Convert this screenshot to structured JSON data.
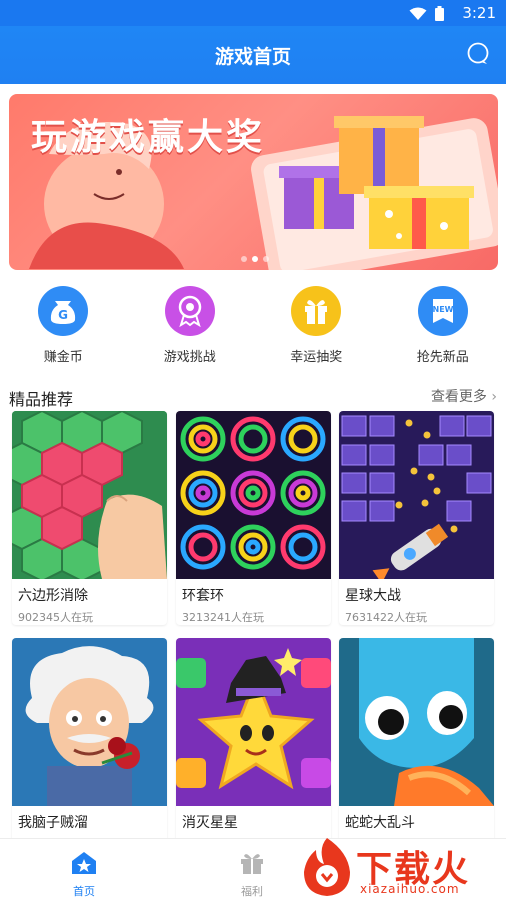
{
  "status": {
    "time": "3:21"
  },
  "header": {
    "title": "游戏首页"
  },
  "banner": {
    "slogan": "玩游戏赢大奖"
  },
  "quick_entries": [
    {
      "label": "赚金币",
      "icon": "gold-coin-bag-icon",
      "color": "#2f8cf5"
    },
    {
      "label": "游戏挑战",
      "icon": "medal-icon",
      "color": "#c850e6"
    },
    {
      "label": "幸运抽奖",
      "icon": "gift-icon",
      "color": "#f7c21a"
    },
    {
      "label": "抢先新品",
      "icon": "new-badge-icon",
      "color": "#2f8cf5"
    }
  ],
  "section": {
    "title": "精品推荐",
    "more": "查看更多"
  },
  "games": [
    {
      "name": "六边形消除",
      "players": "902345人在玩"
    },
    {
      "name": "环套环",
      "players": "3213241人在玩"
    },
    {
      "name": "星球大战",
      "players": "7631422人在玩"
    },
    {
      "name": "我脑子贼溜",
      "players": ""
    },
    {
      "name": "消灭星星",
      "players": ""
    },
    {
      "name": "蛇蛇大乱斗",
      "players": ""
    }
  ],
  "tabs": [
    {
      "label": "首页",
      "icon": "home-icon",
      "active": true
    },
    {
      "label": "福利",
      "icon": "gift-icon",
      "active": false
    }
  ],
  "watermark": {
    "brand": "下载火",
    "url": "xiazaihuo.com"
  },
  "colors": {
    "primary": "#1f80f2",
    "watermark": "#e8371d"
  }
}
